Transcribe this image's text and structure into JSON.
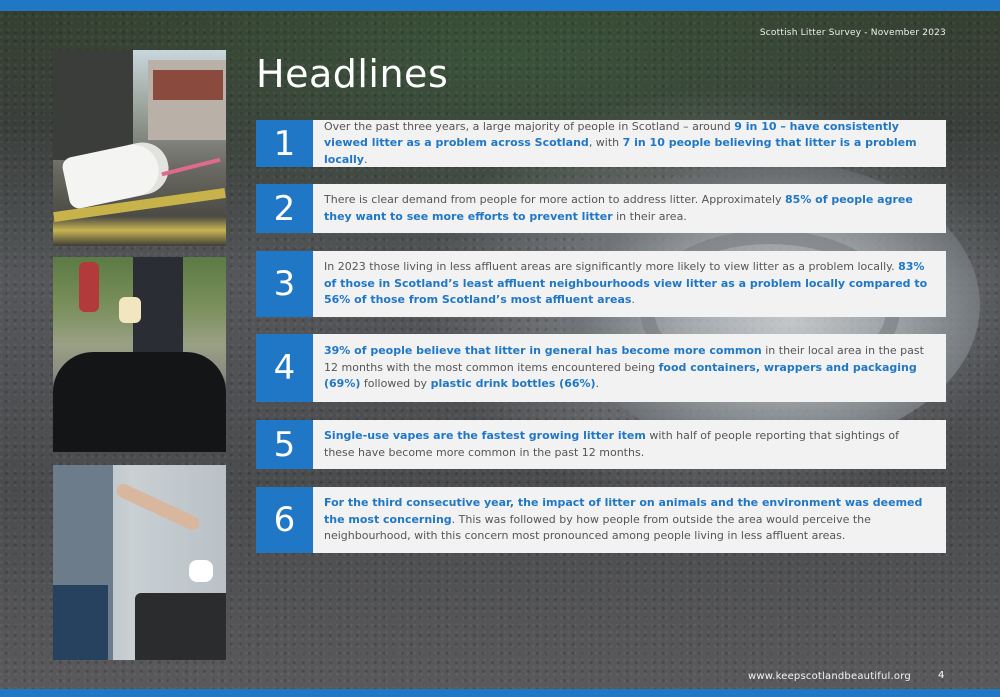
{
  "header": {
    "survey_label": "Scottish Litter Survey - November 2023",
    "title": "Headlines"
  },
  "colors": {
    "accent": "#1f77c6",
    "text": "#555555",
    "card": "#f2f2f2"
  },
  "items": [
    {
      "number": "1",
      "segments": [
        {
          "t": "Over the past three years, a large majority of people in Scotland – around ",
          "b": false
        },
        {
          "t": "9 in 10 – have consistently viewed litter as a problem across Scotland",
          "b": true
        },
        {
          "t": ", with ",
          "b": false
        },
        {
          "t": "7 in 10 people believing that litter is a problem locally",
          "b": true
        },
        {
          "t": ".",
          "b": false
        }
      ]
    },
    {
      "number": "2",
      "segments": [
        {
          "t": "There is clear demand from people for more action to address litter. Approximately ",
          "b": false
        },
        {
          "t": "85% of people agree they want to see more efforts to prevent litter",
          "b": true
        },
        {
          "t": " in their area.",
          "b": false
        }
      ]
    },
    {
      "number": "3",
      "segments": [
        {
          "t": "In 2023 those living in less affluent areas are significantly more likely to view litter as a problem locally. ",
          "b": false
        },
        {
          "t": "83% of those in Scotland’s least affluent neighbourhoods view litter as a problem locally compared to 56% of those from Scotland’s most affluent areas",
          "b": true
        },
        {
          "t": ".",
          "b": false
        }
      ]
    },
    {
      "number": "4",
      "segments": [
        {
          "t": "39% of people believe that litter in general has become more common",
          "b": true
        },
        {
          "t": " in their local area in the past 12 months with the most common items encountered being ",
          "b": false
        },
        {
          "t": "food containers, wrappers and packaging (69%)",
          "b": true
        },
        {
          "t": " followed by ",
          "b": false
        },
        {
          "t": "plastic drink bottles (66%)",
          "b": true
        },
        {
          "t": ".",
          "b": false
        }
      ]
    },
    {
      "number": "5",
      "segments": [
        {
          "t": "Single-use vapes are the fastest growing litter item",
          "b": true
        },
        {
          "t": " with half of people reporting that sightings of these have become more common in the past 12 months.",
          "b": false
        }
      ]
    },
    {
      "number": "6",
      "segments": [
        {
          "t": "For the third consecutive year, the impact of litter on animals and the environment was deemed the most concerning",
          "b": true
        },
        {
          "t": ". This was followed by how people from outside the area would perceive the neighbourhood, with this concern most pronounced among people living in less affluent areas.",
          "b": false
        }
      ]
    }
  ],
  "footer": {
    "url": "www.keepscotlandbeautiful.org",
    "page_number": "4"
  }
}
